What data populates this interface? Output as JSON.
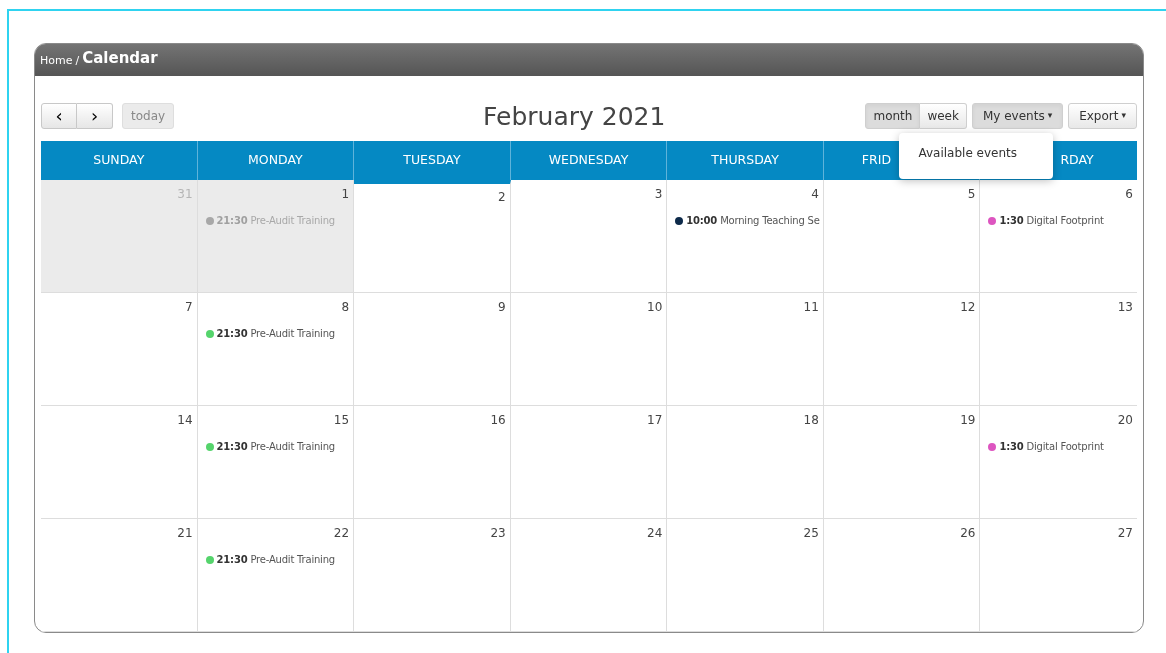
{
  "breadcrumb": {
    "home": "Home",
    "separator": "/",
    "current": "Calendar"
  },
  "toolbar": {
    "prev": "‹",
    "next": "›",
    "today": "today",
    "title": "February 2021",
    "views": [
      {
        "label": "month",
        "selected": true
      },
      {
        "label": "week",
        "selected": false
      }
    ],
    "menus": [
      {
        "label": "My events",
        "caret": "▾",
        "open": true
      },
      {
        "label": "Export",
        "caret": "▾",
        "open": false
      }
    ]
  },
  "dropdown": {
    "items": [
      "Available events"
    ]
  },
  "weekdays": [
    {
      "label": "SUNDAY"
    },
    {
      "label": "MONDAY"
    },
    {
      "label": "TUESDAY"
    },
    {
      "label": "WEDNESDAY"
    },
    {
      "label": "THURSDAY"
    },
    {
      "label": "FRID"
    },
    {
      "label": "RDAY"
    }
  ],
  "weeks": [
    [
      {
        "day": "31",
        "other_month": true,
        "past": true,
        "today": false
      },
      {
        "day": "1",
        "other_month": false,
        "past": true,
        "today": false,
        "events": [
          {
            "time": "21:30",
            "title": "Pre-Audit Training",
            "color": "#a8a8a8"
          }
        ]
      },
      {
        "day": "2",
        "other_month": false,
        "past": false,
        "today": true
      },
      {
        "day": "3",
        "other_month": false,
        "past": false,
        "today": false
      },
      {
        "day": "4",
        "other_month": false,
        "past": false,
        "today": false,
        "events": [
          {
            "time": "10:00",
            "title": "Morning Teaching Se",
            "color": "#0d2a4a"
          }
        ]
      },
      {
        "day": "5",
        "other_month": false,
        "past": false,
        "today": false
      },
      {
        "day": "6",
        "other_month": false,
        "past": false,
        "today": false,
        "events": [
          {
            "time": "1:30",
            "title": "Digital Footprint",
            "color": "#dd55c0"
          }
        ]
      }
    ],
    [
      {
        "day": "7",
        "other_month": false,
        "past": false,
        "today": false
      },
      {
        "day": "8",
        "other_month": false,
        "past": false,
        "today": false,
        "events": [
          {
            "time": "21:30",
            "title": "Pre-Audit Training",
            "color": "#55d46c"
          }
        ]
      },
      {
        "day": "9",
        "other_month": false,
        "past": false,
        "today": false
      },
      {
        "day": "10",
        "other_month": false,
        "past": false,
        "today": false
      },
      {
        "day": "11",
        "other_month": false,
        "past": false,
        "today": false
      },
      {
        "day": "12",
        "other_month": false,
        "past": false,
        "today": false
      },
      {
        "day": "13",
        "other_month": false,
        "past": false,
        "today": false
      }
    ],
    [
      {
        "day": "14",
        "other_month": false,
        "past": false,
        "today": false
      },
      {
        "day": "15",
        "other_month": false,
        "past": false,
        "today": false,
        "events": [
          {
            "time": "21:30",
            "title": "Pre-Audit Training",
            "color": "#55d46c"
          }
        ]
      },
      {
        "day": "16",
        "other_month": false,
        "past": false,
        "today": false
      },
      {
        "day": "17",
        "other_month": false,
        "past": false,
        "today": false
      },
      {
        "day": "18",
        "other_month": false,
        "past": false,
        "today": false
      },
      {
        "day": "19",
        "other_month": false,
        "past": false,
        "today": false
      },
      {
        "day": "20",
        "other_month": false,
        "past": false,
        "today": false,
        "events": [
          {
            "time": "1:30",
            "title": "Digital Footprint",
            "color": "#dd55c0"
          }
        ]
      }
    ],
    [
      {
        "day": "21",
        "other_month": false,
        "past": false,
        "today": false
      },
      {
        "day": "22",
        "other_month": false,
        "past": false,
        "today": false,
        "events": [
          {
            "time": "21:30",
            "title": "Pre-Audit Training",
            "color": "#55d46c"
          }
        ]
      },
      {
        "day": "23",
        "other_month": false,
        "past": false,
        "today": false
      },
      {
        "day": "24",
        "other_month": false,
        "past": false,
        "today": false
      },
      {
        "day": "25",
        "other_month": false,
        "past": false,
        "today": false
      },
      {
        "day": "26",
        "other_month": false,
        "past": false,
        "today": false
      },
      {
        "day": "27",
        "other_month": false,
        "past": false,
        "today": false
      }
    ]
  ]
}
